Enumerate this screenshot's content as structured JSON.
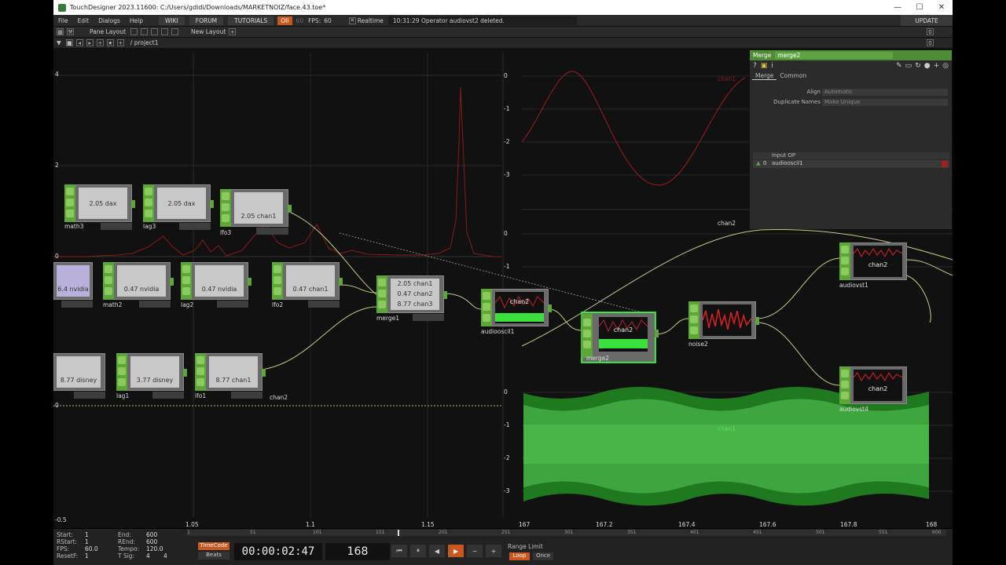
{
  "window": {
    "title": "TouchDesigner 2023.11600: C:/Users/gdidi/Downloads/MARKETNOIZ/face.43.toe*",
    "minimize": "—",
    "maximize": "☐",
    "close": "✕"
  },
  "menubar": {
    "file": "File",
    "edit": "Edit",
    "dialogs": "Dialogs",
    "help": "Help",
    "wiki": "WIKI",
    "forum": "FORUM",
    "tutorials": "TUTORIALS",
    "op_badge": "OII",
    "op_count": "60",
    "fps_label": "FPS:",
    "fps_value": "60",
    "realtime_label": "Realtime",
    "message": "10:31:29 Operator audiovst2 deleted.",
    "update": "UPDATE"
  },
  "panebar": {
    "pane_layout": "Pane Layout",
    "new_layout": "New Layout",
    "add": "+",
    "zero": "0"
  },
  "pathbar": {
    "path": "/ project1",
    "zero": "0"
  },
  "graph": {
    "left_y_ticks": [
      "4",
      "2",
      "0",
      "0",
      "-0.5"
    ],
    "left_x_ticks": [
      "1.05",
      "1.1",
      "1.15"
    ],
    "right_y_ticks_top": [
      "0",
      "-1",
      "-2",
      "-3"
    ],
    "right_y_ticks_mid": [
      "0",
      "-1"
    ],
    "right_y_ticks_bot": [
      "0",
      "-1",
      "-2",
      "-3"
    ],
    "right_x_ticks": [
      "167",
      "167.2",
      "167.4",
      "167.6",
      "167.8",
      "168"
    ],
    "chan_label": "chan1",
    "chan2_label_top": "chan2",
    "chan2_label_left": "chan2",
    "green_wave_label": "chan1"
  },
  "nodes": [
    {
      "id": "math3",
      "name": "math3",
      "text": "2.05 dax"
    },
    {
      "id": "lag3",
      "name": "lag3",
      "text": "2.05 dax"
    },
    {
      "id": "lfo3",
      "name": "lfo3",
      "text": "2.05 chan1"
    },
    {
      "id": "unnamed1",
      "name": "",
      "text": "6.4 nvidia"
    },
    {
      "id": "math2",
      "name": "math2",
      "text": "0.47 nvidia"
    },
    {
      "id": "lag2",
      "name": "lag2",
      "text": "0.47 nvidia"
    },
    {
      "id": "lfo2",
      "name": "lfo2",
      "text": "0.47 chan1"
    },
    {
      "id": "merge1",
      "name": "merge1",
      "lines": [
        "2.05 chan1",
        "0.47 chan2",
        "8.77 chan3"
      ]
    },
    {
      "id": "unnamed2",
      "name": "",
      "text": "8.77 disney"
    },
    {
      "id": "lag1",
      "name": "lag1",
      "text": "3.77 disney"
    },
    {
      "id": "lfo1",
      "name": "lfo1",
      "text": "8.77 chan1"
    },
    {
      "id": "audiooscil1",
      "name": "audiooscil1",
      "text": "chan2"
    },
    {
      "id": "merge2",
      "name": "merge2",
      "text": "chan2"
    },
    {
      "id": "noise2",
      "name": "noise2",
      "text": ""
    },
    {
      "id": "audiovst1",
      "name": "audiovst1",
      "text": "chan2"
    },
    {
      "id": "audiovst4",
      "name": "audiovst4",
      "text": "chan2"
    }
  ],
  "params": {
    "type": "Merge",
    "name": "merge2",
    "tab_merge": "Merge",
    "tab_common": "Common",
    "align_label": "Align",
    "align_value": "Automatic",
    "dupnames_label": "Duplicate Names",
    "dupnames_value": "Make Unique",
    "input_header": "Input OP",
    "input_index": "0",
    "input_value": "audiooscil1"
  },
  "transport": {
    "start_label": "Start:",
    "start": "1",
    "end_label": "End:",
    "end": "600",
    "rstart_label": "RStart:",
    "rstart": "1",
    "rend_label": "REnd:",
    "rend": "600",
    "fps_label": "FPS:",
    "fps": "60.0",
    "tempo_label": "Tempo:",
    "tempo": "120.0",
    "resetf_label": "ResetF:",
    "resetf": "1",
    "tsig_label": "T Sig:",
    "tsig_a": "4",
    "tsig_b": "4",
    "timecode": "TimeCode",
    "beats": "Beats",
    "time": "00:00:02:47",
    "frame": "168",
    "range_limit": "Range Limit",
    "loop": "Loop",
    "once": "Once",
    "ruler": [
      "1",
      "51",
      "101",
      "151",
      "201",
      "251",
      "301",
      "351",
      "401",
      "451",
      "501",
      "551",
      "600"
    ]
  }
}
